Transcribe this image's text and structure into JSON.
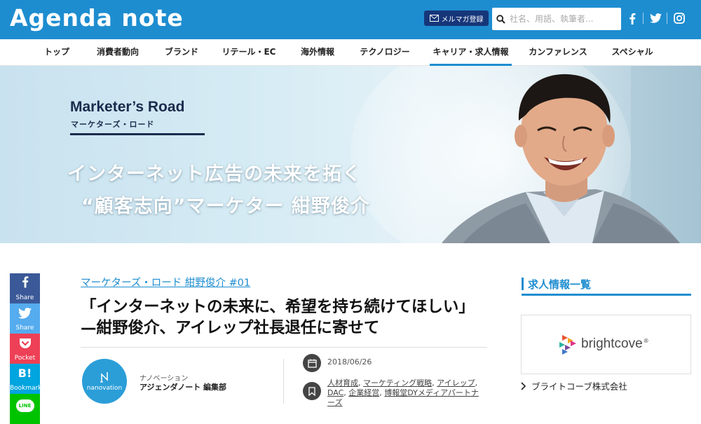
{
  "header": {
    "logo": "Agenda note",
    "mail_button": "メルマガ登録",
    "search_placeholder": "社名、用語、執筆者...",
    "social": [
      "facebook-icon",
      "twitter-icon",
      "instagram-icon"
    ],
    "colors": {
      "header_bg": "#1e8dd0",
      "mail_bg": "#16367a"
    }
  },
  "nav": {
    "items": [
      "トップ",
      "消費者動向",
      "ブランド",
      "リテール・EC",
      "海外情報",
      "テクノロジー",
      "キャリア・求人情報",
      "カンファレンス",
      "スペシャル"
    ],
    "active": "キャリア・求人情報"
  },
  "hero": {
    "series_title": "Marketer’s Road",
    "series_subtitle": "マーケターズ・ロード",
    "headline_1": "インターネット広告の未来を拓く",
    "headline_2": "“顧客志向”マーケター 紺野俊介"
  },
  "share": {
    "facebook": "Share",
    "twitter": "Share",
    "pocket": "Pocket",
    "hatena": "Bookmark",
    "hatena_mark": "B!",
    "line": "LINE"
  },
  "article": {
    "category": "マーケターズ・ロード 紺野俊介 #01",
    "title": "「インターネットの未来に、希望を持ち続けてほしい」—紺野俊介、アイレップ社長退任に寄せて",
    "author_logo_text": "nanovation",
    "author_org": "ナノベーション",
    "author_name": "アジェンダノート 編集部",
    "date": "2018/06/26",
    "tags": [
      "人材育成",
      "マーケティング戦略",
      "アイレップ",
      "DAC",
      "企業経営",
      "博報堂DYメディアパートナーズ"
    ]
  },
  "sidebar": {
    "heading": "求人情報一覧",
    "company_logo_text": "brightcove",
    "company_logo_mark": "®",
    "company_name": "ブライトコーブ株式会社"
  }
}
